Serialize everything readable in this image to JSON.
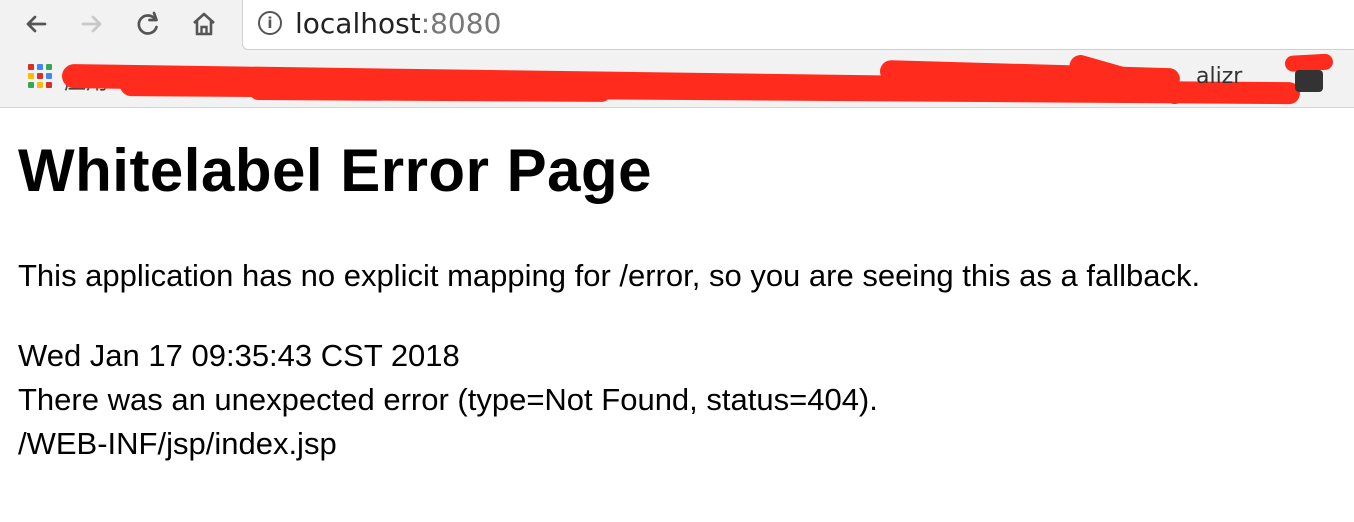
{
  "browser": {
    "address": {
      "host": "localhost",
      "port": ":8080"
    },
    "bookmarks": {
      "apps_label": "应用",
      "partial_item": "alizr"
    },
    "icons": {
      "back": "back-arrow-icon",
      "forward": "forward-arrow-icon",
      "reload": "reload-icon",
      "home": "home-icon",
      "info": "info-icon",
      "apps": "apps-grid-icon"
    },
    "redaction_color": "#ff2b1d"
  },
  "page": {
    "title": "Whitelabel Error Page",
    "explanation": "This application has no explicit mapping for /error, so you are seeing this as a fallback.",
    "timestamp": "Wed Jan 17 09:35:43 CST 2018",
    "error_message": "There was an unexpected error (type=Not Found, status=404).",
    "path": "/WEB-INF/jsp/index.jsp"
  }
}
